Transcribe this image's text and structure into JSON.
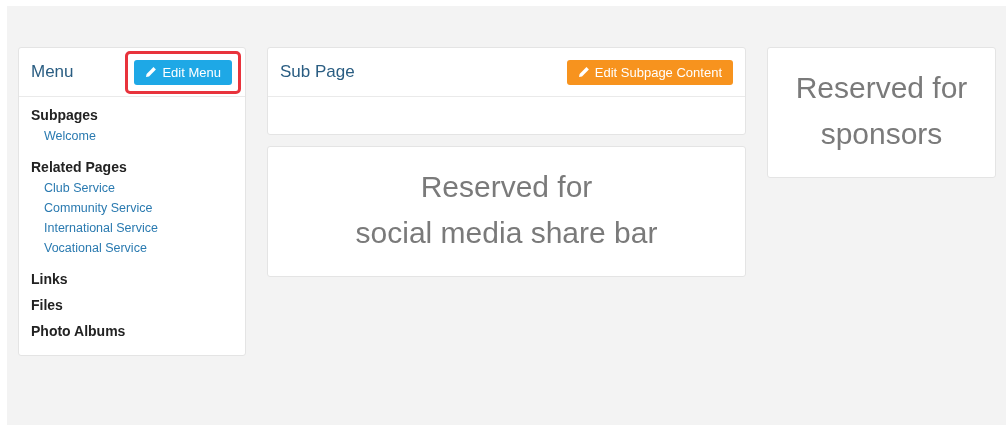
{
  "menu": {
    "title": "Menu",
    "edit_button": {
      "label": "Edit Menu",
      "highlighted": true
    },
    "sections": [
      {
        "title": "Subpages",
        "links": [
          "Welcome"
        ]
      },
      {
        "title": "Related Pages",
        "links": [
          "Club Service",
          "Community Service",
          "International Service",
          "Vocational Service"
        ]
      },
      {
        "title": "Links"
      },
      {
        "title": "Files"
      },
      {
        "title": "Photo Albums"
      }
    ]
  },
  "sub_page": {
    "title": "Sub Page",
    "edit_button": {
      "label": "Edit Subpage Content"
    }
  },
  "share_bar_placeholder": {
    "lines": [
      "Reserved for",
      "social media share bar"
    ]
  },
  "sponsors_placeholder": {
    "lines": [
      "Reserved for",
      "sponsors"
    ]
  }
}
